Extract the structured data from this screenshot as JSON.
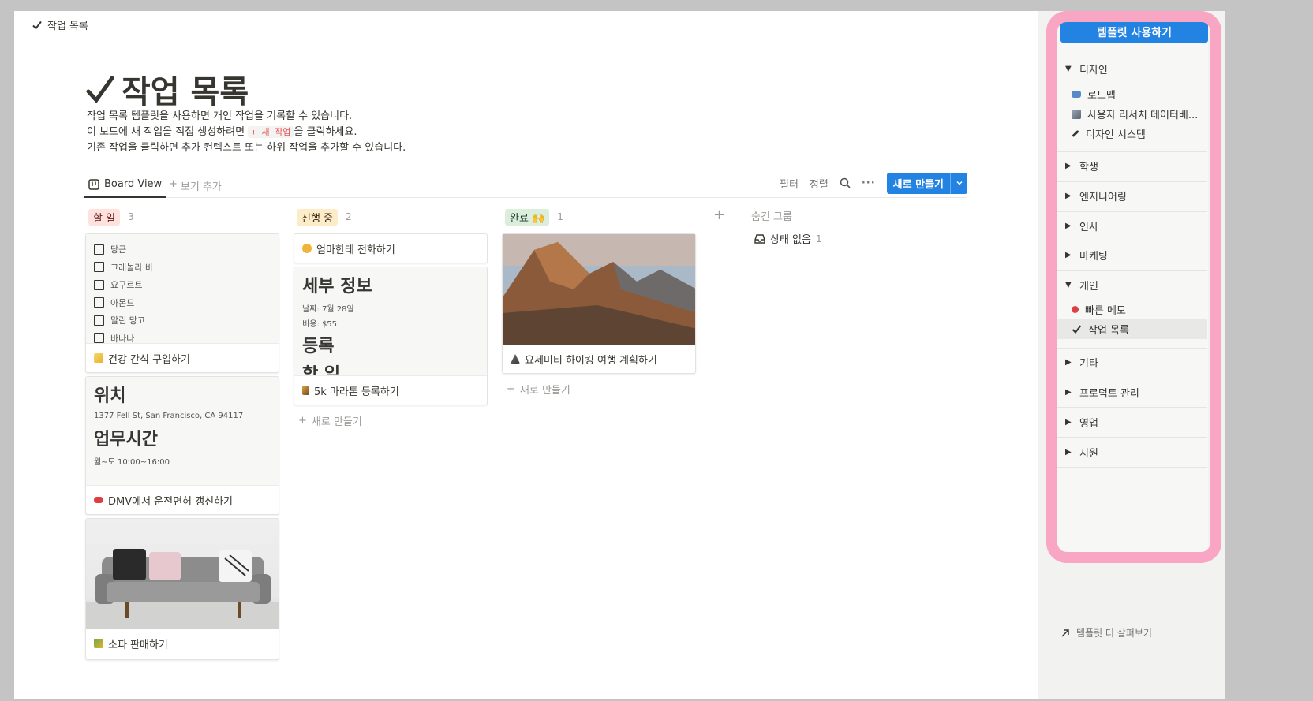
{
  "breadcrumb": {
    "label": "작업 목록"
  },
  "page": {
    "title": "작업 목록",
    "desc": {
      "line1": "작업 목록 템플릿을 사용하면 개인 작업을 기록할 수 있습니다.",
      "line2_before": "이 보드에 새 작업을 직접 생성하려면 ",
      "line2_code": "+ 새 작업",
      "line2_after": "을 클릭하세요.",
      "line3": "기존 작업을 클릭하면 추가 컨텍스트 또는 하위 작업을 추가할 수 있습니다."
    }
  },
  "viewbar": {
    "board_view": "Board View",
    "add_view": "보기 추가",
    "filter": "필터",
    "sort": "정렬",
    "new_button": "새로 만들기"
  },
  "columns": {
    "todo": {
      "label": "할 일",
      "count": "3",
      "checklist": [
        "당근",
        "그래놀라 바",
        "요구르트",
        "아몬드",
        "말린 망고",
        "바나나"
      ],
      "card1_title": "건강 간식 구입하기",
      "card2_h1": "위치",
      "card2_addr": "1377 Fell St, San Francisco, CA 94117",
      "card2_h2": "업무시간",
      "card2_hours": "월~토 10:00~16:00",
      "card2_title": "DMV에서 운전면허 갱신하기",
      "card3_title": "소파 판매하기"
    },
    "doing": {
      "label": "진행 중",
      "count": "2",
      "card1_title": "엄마한테 전화하기",
      "card2_h1": "세부 정보",
      "card2_date": "날짜: 7월 28일",
      "card2_cost": "비용: $55",
      "card2_h2": "등록",
      "card2_h3": "할 일",
      "card2_title": "5k 마라톤 등록하기",
      "new_item": "새로 만들기"
    },
    "done": {
      "label": "완료 🙌",
      "count": "1",
      "card1_title": "요세미티 하이킹 여행 계획하기",
      "new_item": "새로 만들기"
    },
    "hidden": {
      "label": "숨긴 그룹",
      "item": "상태 없음",
      "count": "1"
    }
  },
  "sidebar": {
    "use_template": "템플릿 사용하기",
    "categories": {
      "design": "디자인",
      "design_items": [
        "로드맵",
        "사용자 리서치 데이터베...",
        "디자인 시스템"
      ],
      "student": "학생",
      "engineering": "엔지니어링",
      "hr": "인사",
      "marketing": "마케팅",
      "personal": "개인",
      "personal_items": [
        "빠른 메모",
        "작업 목록"
      ],
      "other": "기타",
      "product": "프로덕트 관리",
      "sales": "영업",
      "support": "지원"
    },
    "browse_more": "템플릿 더 살펴보기"
  },
  "colors": {
    "accent_blue": "#2383e2",
    "todo_tag_bg": "#ffe2dd",
    "doing_tag_bg": "#fdecc8",
    "done_tag_bg": "#dbeddb",
    "highlight_pink": "#f8a6c4"
  }
}
